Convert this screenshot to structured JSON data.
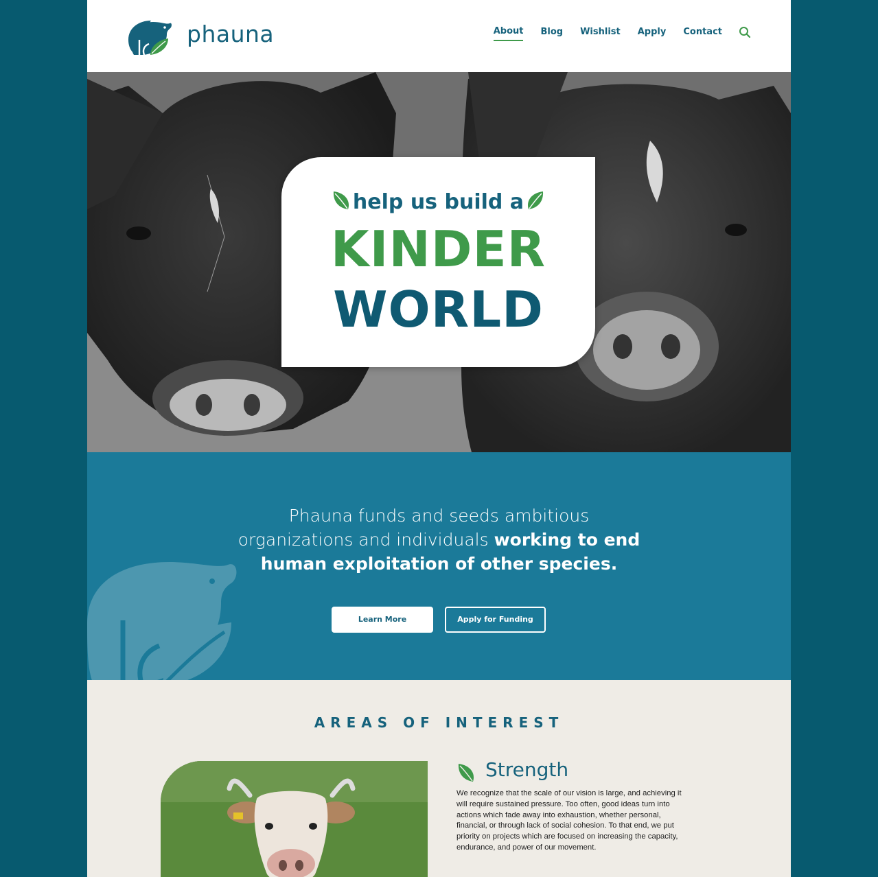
{
  "brand": {
    "name": "phauna",
    "logo_icon": "pig-leaf-logo-icon"
  },
  "nav": {
    "items": [
      {
        "label": "About",
        "active": true
      },
      {
        "label": "Blog",
        "active": false
      },
      {
        "label": "Wishlist",
        "active": false
      },
      {
        "label": "Apply",
        "active": false
      },
      {
        "label": "Contact",
        "active": false
      }
    ],
    "search_icon": "search-icon"
  },
  "hero": {
    "tagline": "help us build a",
    "line1": "KINDER",
    "line2": "WORLD"
  },
  "mission": {
    "text_regular_1": "Phauna funds and seeds ambitious",
    "text_regular_2": "organizations and individuals ",
    "text_bold_1": "working to end",
    "text_bold_2": "human exploitation of other species.",
    "learn_more": "Learn More",
    "apply_funding": "Apply for Funding"
  },
  "areas": {
    "title": "AREAS OF INTEREST",
    "item_title": "Strength",
    "item_body": "We recognize that the scale of our vision is large, and achieving it will require sustained pressure. Too often, good ideas turn into actions which fade away into exhaustion, whether personal, financial, or through lack of social cohesion. To that end, we put priority on projects which are focused on increasing the capacity, endurance, and power of our movement."
  },
  "colors": {
    "frame": "#075a6f",
    "primary": "#16627c",
    "accent_green": "#3f9a4a",
    "mission_bg": "#1b7a99",
    "areas_bg": "#efece6"
  }
}
